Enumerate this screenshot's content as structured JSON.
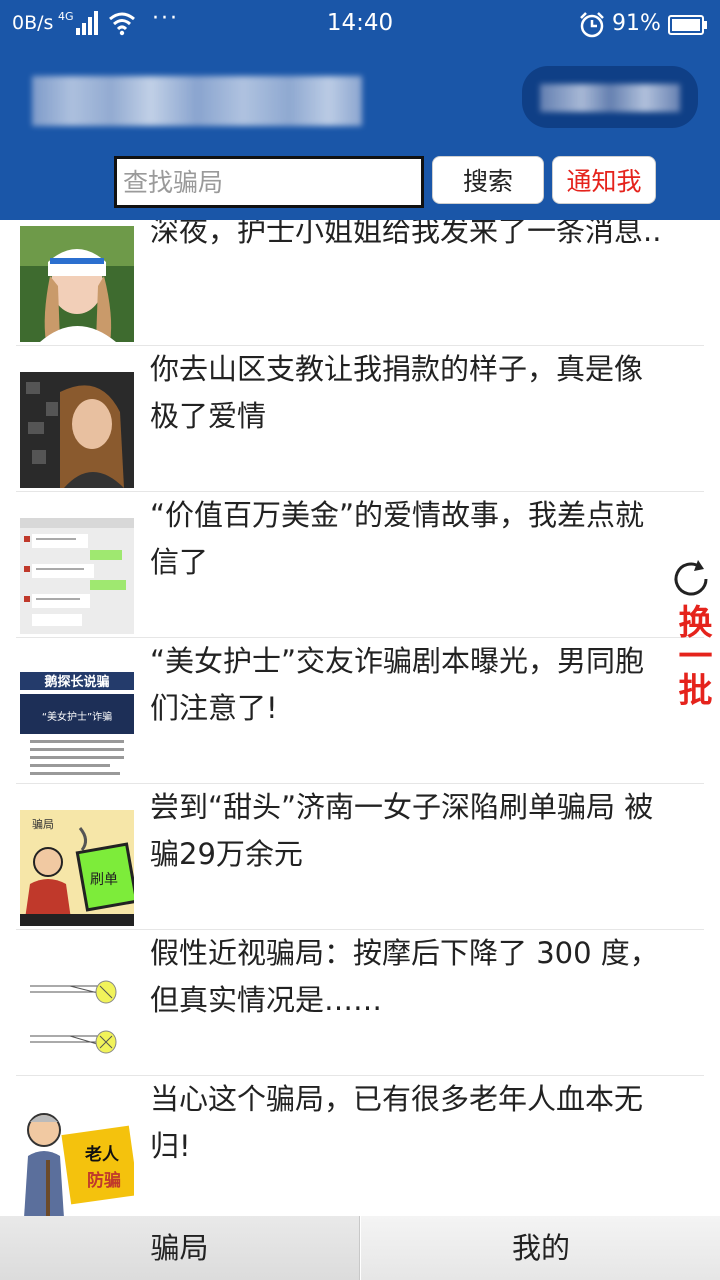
{
  "status_bar": {
    "net_speed": "0B/s",
    "network": "4G",
    "more": "···",
    "time": "14:40",
    "battery": "91%",
    "icons": [
      "signal-icon",
      "wifi-icon",
      "alarm-icon",
      "battery-icon"
    ]
  },
  "header": {
    "search": {
      "placeholder": "查找骗局",
      "value": ""
    },
    "search_button": "搜索",
    "notify_button": "通知我"
  },
  "articles": [
    {
      "title": "深夜，护士小姐姐给我发来了一条消息..",
      "thumb": "nurse-photo"
    },
    {
      "title": "你去山区支教让我捐款的样子，真是像极了爱情",
      "thumb": "woman-photo"
    },
    {
      "title": "“价值百万美金”的爱情故事，我差点就信了",
      "thumb": "chat-screenshot"
    },
    {
      "title": "“美女护士”交友诈骗剧本曝光，男同胞们注意了!",
      "thumb": "poster-image"
    },
    {
      "title": "尝到“甜头”济南一女子深陷刷单骗局 被骗29万余元",
      "thumb": "cartoon-image"
    },
    {
      "title": "假性近视骗局：按摩后下降了 300 度，但真实情况是……",
      "thumb": "eye-diagram"
    },
    {
      "title": "当心这个骗局，已有很多老年人血本无归!",
      "thumb": "elderly-cartoon"
    }
  ],
  "thumb_texts": {
    "poster_title": "鹅探长说骗",
    "poster_sub": "“美女护士”诈骗",
    "cartoon_tag": "骗局",
    "cartoon_screen": "刷单",
    "elderly_line1": "老人",
    "elderly_line2": "防骗"
  },
  "refresh": {
    "label": "换一批"
  },
  "tabs": [
    {
      "label": "骗局",
      "active": true
    },
    {
      "label": "我的",
      "active": false
    }
  ],
  "colors": {
    "header_bg": "#1a56a8",
    "accent_red": "#e5231c"
  }
}
